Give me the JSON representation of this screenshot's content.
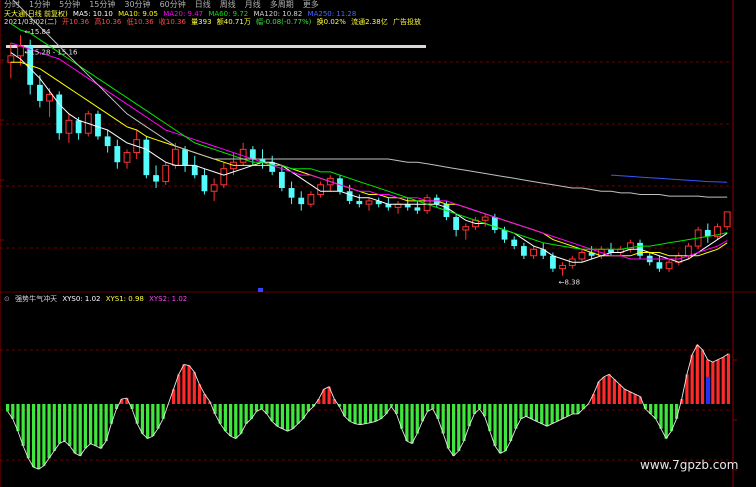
{
  "tabs": [
    "分时",
    "1分钟",
    "5分钟",
    "15分钟",
    "30分钟",
    "60分钟",
    "日线",
    "周线",
    "月线",
    "多周期",
    "更多"
  ],
  "header": {
    "stock": "天大通(日线 前复权)",
    "ma5": "MA5: 10.10",
    "ma10": "MA10: 9.05",
    "ma20": "MA20: 9.47",
    "ma60": "MA60: 9.72",
    "ma120": "MA120: 10.82",
    "ma250": "MA250: 11.28",
    "date": "2021/03/02(二)",
    "open": "开10.36",
    "high": "高10.36",
    "low": "低10.36",
    "close": "收10.36",
    "volume": "量393",
    "amount": "额40.71万",
    "change": "幅-0.08(-0.77%)",
    "turnover": "换0.02%",
    "float": "流通2.38亿",
    "ad": "广告投放"
  },
  "annotations": {
    "high1": "15.84",
    "high2": "15.28 - 15.16",
    "low": "8.38"
  },
  "indicator": {
    "name": "强势牛气冲天",
    "xys0": "XYS0: 1.02",
    "xys1": "XYS1: 0.98",
    "xys2": "XYS2: 1.02"
  },
  "watermark": "www.7gpzb.com",
  "colors": {
    "up": "#ff3232",
    "down": "#54fcfc",
    "ma5": "#ffffff",
    "ma10": "#ffff00",
    "ma20": "#ff00ff",
    "ma60": "#00e600",
    "ma120": "#c0c0c0",
    "ma250": "#3a56ff",
    "green": "#3ee63e",
    "red": "#ff2a2a",
    "blue": "#2230ff",
    "grid": "#8b0000"
  },
  "chart_data": [
    {
      "type": "candlestick",
      "ylim": [
        8,
        16
      ],
      "candles": [
        [
          15.0,
          15.6,
          14.5,
          15.2
        ],
        [
          15.2,
          15.84,
          14.9,
          15.5
        ],
        [
          15.5,
          15.7,
          14.0,
          14.3
        ],
        [
          14.3,
          14.6,
          13.6,
          13.8
        ],
        [
          13.8,
          14.2,
          13.3,
          14.0
        ],
        [
          14.0,
          14.1,
          12.6,
          12.8
        ],
        [
          12.8,
          13.4,
          12.5,
          13.2
        ],
        [
          13.2,
          13.3,
          12.6,
          12.8
        ],
        [
          12.8,
          13.5,
          12.7,
          13.4
        ],
        [
          13.4,
          13.5,
          12.6,
          12.7
        ],
        [
          12.7,
          12.9,
          12.2,
          12.4
        ],
        [
          12.4,
          12.6,
          11.7,
          11.9
        ],
        [
          11.9,
          12.3,
          11.7,
          12.2
        ],
        [
          12.2,
          12.9,
          12.0,
          12.6
        ],
        [
          12.6,
          12.7,
          11.4,
          11.5
        ],
        [
          11.5,
          11.8,
          11.1,
          11.3
        ],
        [
          11.3,
          11.9,
          11.2,
          11.8
        ],
        [
          11.8,
          12.5,
          11.7,
          12.3
        ],
        [
          12.3,
          12.4,
          11.6,
          11.8
        ],
        [
          11.8,
          12.1,
          11.4,
          11.5
        ],
        [
          11.5,
          11.7,
          10.9,
          11.0
        ],
        [
          11.0,
          11.4,
          10.7,
          11.2
        ],
        [
          11.2,
          11.9,
          11.1,
          11.7
        ],
        [
          11.7,
          12.2,
          11.5,
          11.9
        ],
        [
          11.9,
          12.5,
          11.8,
          12.3
        ],
        [
          12.3,
          12.4,
          11.8,
          12.0
        ],
        [
          12.0,
          12.3,
          11.7,
          11.9
        ],
        [
          11.9,
          12.1,
          11.5,
          11.6
        ],
        [
          11.6,
          11.8,
          11.0,
          11.1
        ],
        [
          11.1,
          11.3,
          10.6,
          10.8
        ],
        [
          10.8,
          11.0,
          10.4,
          10.6
        ],
        [
          10.6,
          11.0,
          10.5,
          10.9
        ],
        [
          10.9,
          11.3,
          10.8,
          11.2
        ],
        [
          11.2,
          11.5,
          11.0,
          11.4
        ],
        [
          11.4,
          11.5,
          10.9,
          11.0
        ],
        [
          11.0,
          11.2,
          10.6,
          10.7
        ],
        [
          10.7,
          10.9,
          10.5,
          10.6
        ],
        [
          10.6,
          10.8,
          10.4,
          10.7
        ],
        [
          10.7,
          10.8,
          10.5,
          10.6
        ],
        [
          10.6,
          10.8,
          10.4,
          10.5
        ],
        [
          10.5,
          10.7,
          10.3,
          10.6
        ],
        [
          10.6,
          10.8,
          10.4,
          10.5
        ],
        [
          10.5,
          10.7,
          10.3,
          10.4
        ],
        [
          10.4,
          10.9,
          10.3,
          10.8
        ],
        [
          10.8,
          10.9,
          10.5,
          10.6
        ],
        [
          10.6,
          10.7,
          10.1,
          10.2
        ],
        [
          10.2,
          10.3,
          9.6,
          9.8
        ],
        [
          9.8,
          10.0,
          9.5,
          9.9
        ],
        [
          9.9,
          10.2,
          9.8,
          10.1
        ],
        [
          10.1,
          10.3,
          9.9,
          10.2
        ],
        [
          10.2,
          10.3,
          9.7,
          9.8
        ],
        [
          9.8,
          9.9,
          9.4,
          9.5
        ],
        [
          9.5,
          9.6,
          9.2,
          9.3
        ],
        [
          9.3,
          9.4,
          8.9,
          9.0
        ],
        [
          9.0,
          9.3,
          8.9,
          9.2
        ],
        [
          9.2,
          9.4,
          8.9,
          9.0
        ],
        [
          9.0,
          9.1,
          8.5,
          8.6
        ],
        [
          8.6,
          8.8,
          8.38,
          8.7
        ],
        [
          8.7,
          9.0,
          8.6,
          8.9
        ],
        [
          8.9,
          9.2,
          8.8,
          9.1
        ],
        [
          9.1,
          9.3,
          8.9,
          9.0
        ],
        [
          9.0,
          9.3,
          8.9,
          9.2
        ],
        [
          9.2,
          9.4,
          9.0,
          9.1
        ],
        [
          9.1,
          9.3,
          9.0,
          9.2
        ],
        [
          9.2,
          9.5,
          9.1,
          9.4
        ],
        [
          9.4,
          9.5,
          8.9,
          9.0
        ],
        [
          9.0,
          9.1,
          8.7,
          8.8
        ],
        [
          8.8,
          9.0,
          8.5,
          8.6
        ],
        [
          8.6,
          8.9,
          8.5,
          8.8
        ],
        [
          8.8,
          9.1,
          8.7,
          9.0
        ],
        [
          9.0,
          9.4,
          8.9,
          9.3
        ],
        [
          9.3,
          9.9,
          9.2,
          9.8
        ],
        [
          9.8,
          10.0,
          9.4,
          9.6
        ],
        [
          9.6,
          10.0,
          9.5,
          9.9
        ],
        [
          9.9,
          10.36,
          9.8,
          10.36
        ]
      ],
      "ma_series": [
        {
          "name": "MA5",
          "values": [
            15.3,
            15.1,
            14.8,
            14.5,
            14.1,
            13.7,
            13.4,
            13.2,
            13.1,
            13.0,
            12.9,
            12.7,
            12.5,
            12.4,
            12.3,
            12.1,
            11.9,
            11.8,
            11.8,
            11.8,
            11.7,
            11.6,
            11.5,
            11.6,
            11.7,
            11.8,
            11.9,
            11.9,
            11.8,
            11.6,
            11.4,
            11.2,
            11.0,
            11.0,
            11.0,
            10.9,
            10.8,
            10.8,
            10.7,
            10.6,
            10.6,
            10.6,
            10.6,
            10.6,
            10.6,
            10.5,
            10.3,
            10.1,
            10.0,
            10.0,
            9.9,
            9.8,
            9.7,
            9.5,
            9.3,
            9.2,
            9.0,
            8.9,
            8.8,
            8.8,
            8.9,
            9.0,
            9.1,
            9.1,
            9.2,
            9.2,
            9.1,
            9.0,
            8.9,
            8.8,
            8.9,
            9.1,
            9.3,
            9.5,
            9.7
          ]
        },
        {
          "name": "MA10",
          "values": [
            15.0,
            15.0,
            14.9,
            14.8,
            14.6,
            14.4,
            14.2,
            14.0,
            13.8,
            13.6,
            13.4,
            13.2,
            13.0,
            12.9,
            12.7,
            12.6,
            12.5,
            12.4,
            12.3,
            12.2,
            12.1,
            12.0,
            11.9,
            11.8,
            11.8,
            11.8,
            11.8,
            11.8,
            11.8,
            11.7,
            11.6,
            11.5,
            11.4,
            11.3,
            11.2,
            11.1,
            11.0,
            10.9,
            10.9,
            10.8,
            10.8,
            10.7,
            10.7,
            10.7,
            10.7,
            10.6,
            10.6,
            10.5,
            10.4,
            10.3,
            10.2,
            10.1,
            10.0,
            9.9,
            9.8,
            9.7,
            9.5,
            9.4,
            9.3,
            9.2,
            9.1,
            9.0,
            9.0,
            9.0,
            9.0,
            9.1,
            9.1,
            9.1,
            9.0,
            9.0,
            9.0,
            9.0,
            9.1,
            9.2,
            9.4
          ]
        },
        {
          "name": "MA20",
          "values": [
            15.6,
            15.5,
            15.4,
            15.3,
            15.2,
            15.1,
            14.9,
            14.7,
            14.5,
            14.3,
            14.1,
            13.9,
            13.7,
            13.5,
            13.3,
            13.1,
            12.9,
            12.8,
            12.7,
            12.6,
            12.5,
            12.4,
            12.3,
            12.2,
            12.1,
            12.0,
            11.9,
            11.8,
            11.7,
            11.6,
            11.5,
            11.5,
            11.4,
            11.3,
            11.2,
            11.1,
            11.0,
            11.0,
            10.9,
            10.9,
            10.8,
            10.8,
            10.8,
            10.7,
            10.7,
            10.7,
            10.6,
            10.5,
            10.4,
            10.3,
            10.2,
            10.1,
            10.0,
            9.9,
            9.8,
            9.7,
            9.6,
            9.5,
            9.4,
            9.3,
            9.2,
            9.1,
            9.0,
            9.0,
            8.9,
            8.9,
            8.9,
            8.9,
            8.9,
            8.9,
            9.0,
            9.1,
            9.2,
            9.3,
            9.47
          ]
        },
        {
          "name": "MA60",
          "values": [
            16.2,
            16.0,
            15.9,
            15.7,
            15.5,
            15.3,
            15.1,
            14.9,
            14.7,
            14.5,
            14.3,
            14.1,
            13.9,
            13.7,
            13.5,
            13.3,
            13.1,
            12.9,
            12.7,
            12.5,
            12.4,
            12.3,
            12.2,
            12.1,
            12.0,
            11.9,
            11.9,
            11.8,
            11.8,
            11.7,
            11.7,
            11.7,
            11.6,
            11.6,
            11.5,
            11.4,
            11.3,
            11.2,
            11.1,
            11.0,
            10.9,
            10.8,
            10.7,
            10.6,
            10.5,
            10.4,
            10.3,
            10.2,
            10.1,
            10.0,
            9.9,
            9.8,
            9.7,
            9.6,
            9.5,
            9.4,
            9.35,
            9.3,
            9.25,
            9.2,
            9.2,
            9.2,
            9.2,
            9.2,
            9.25,
            9.3,
            9.3,
            9.35,
            9.4,
            9.45,
            9.5,
            9.55,
            9.6,
            9.65,
            9.72
          ]
        },
        {
          "name": "MA120",
          "values": [
            17.0,
            16.7,
            16.4,
            16.1,
            15.8,
            15.5,
            15.2,
            14.9,
            14.6,
            14.3,
            14.0,
            13.7,
            13.4,
            13.2,
            13.0,
            12.8,
            12.6,
            12.4,
            12.3,
            12.2,
            12.1,
            12.0,
            12.0,
            12.0,
            12.0,
            12.0,
            12.0,
            12.0,
            12.0,
            12.0,
            12.0,
            12.0,
            12.0,
            12.0,
            12.0,
            12.0,
            12.0,
            12.0,
            12.0,
            12.0,
            11.95,
            11.9,
            11.9,
            11.85,
            11.8,
            11.75,
            11.7,
            11.65,
            11.6,
            11.55,
            11.5,
            11.45,
            11.4,
            11.35,
            11.3,
            11.25,
            11.2,
            11.15,
            11.1,
            11.1,
            11.05,
            11.0,
            11.0,
            10.95,
            10.95,
            10.9,
            10.9,
            10.9,
            10.85,
            10.85,
            10.85,
            10.85,
            10.82,
            10.82,
            10.82
          ]
        },
        {
          "name": "MA250",
          "values": [
            null,
            null,
            null,
            null,
            null,
            null,
            null,
            null,
            null,
            null,
            null,
            null,
            null,
            null,
            null,
            null,
            null,
            null,
            null,
            null,
            null,
            null,
            null,
            null,
            null,
            null,
            null,
            null,
            null,
            null,
            null,
            null,
            null,
            null,
            null,
            null,
            null,
            null,
            null,
            null,
            null,
            null,
            null,
            null,
            null,
            null,
            null,
            null,
            null,
            null,
            null,
            null,
            null,
            null,
            null,
            null,
            null,
            null,
            null,
            null,
            null,
            null,
            11.5,
            11.48,
            11.46,
            11.44,
            11.42,
            11.4,
            11.38,
            11.36,
            11.34,
            11.32,
            11.3,
            11.29,
            11.28
          ]
        }
      ]
    },
    {
      "type": "bar",
      "name": "强势牛气冲天",
      "ylim": [
        -1.5,
        1.5
      ],
      "bars": [
        -0.15,
        -0.3,
        -0.55,
        -0.85,
        -1.1,
        -1.28,
        -1.32,
        -1.25,
        -1.1,
        -0.95,
        -0.8,
        -0.75,
        -0.85,
        -1.0,
        -1.05,
        -0.9,
        -0.8,
        -0.85,
        -0.9,
        -0.75,
        -0.4,
        -0.1,
        0.1,
        0.12,
        -0.1,
        -0.4,
        -0.6,
        -0.7,
        -0.65,
        -0.5,
        -0.3,
        0.0,
        0.3,
        0.6,
        0.8,
        0.78,
        0.65,
        0.4,
        0.2,
        0.05,
        -0.2,
        -0.4,
        -0.55,
        -0.65,
        -0.7,
        -0.6,
        -0.4,
        -0.3,
        -0.15,
        -0.1,
        -0.2,
        -0.35,
        -0.45,
        -0.5,
        -0.55,
        -0.5,
        -0.4,
        -0.3,
        -0.15,
        -0.05,
        0.1,
        0.3,
        0.35,
        0.1,
        -0.05,
        -0.25,
        -0.35,
        -0.4,
        -0.42,
        -0.4,
        -0.38,
        -0.35,
        -0.3,
        -0.2,
        -0.05,
        -0.2,
        -0.5,
        -0.75,
        -0.8,
        -0.6,
        -0.35,
        -0.15,
        -0.1,
        -0.3,
        -0.6,
        -0.9,
        -1.05,
        -0.95,
        -0.75,
        -0.45,
        -0.2,
        -0.1,
        -0.25,
        -0.55,
        -0.85,
        -1.0,
        -0.95,
        -0.75,
        -0.5,
        -0.3,
        -0.25,
        -0.3,
        -0.35,
        -0.4,
        -0.45,
        -0.4,
        -0.35,
        -0.3,
        -0.25,
        -0.2,
        -0.2,
        -0.1,
        0.0,
        0.2,
        0.45,
        0.55,
        0.6,
        0.5,
        0.4,
        0.3,
        0.25,
        0.2,
        0.15,
        -0.1,
        -0.2,
        -0.3,
        -0.5,
        -0.7,
        -0.55,
        -0.3,
        0.1,
        0.6,
        1.0,
        1.2,
        1.1,
        0.9,
        0.85,
        0.9,
        0.95,
        1.02
      ]
    }
  ]
}
